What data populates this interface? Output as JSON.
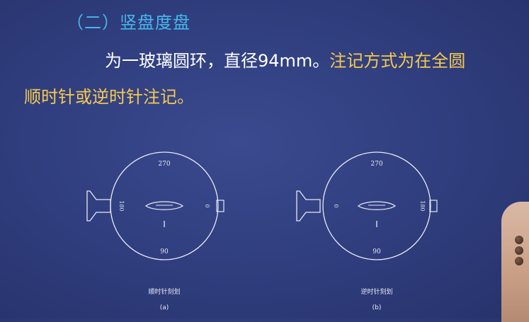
{
  "heading": "（二）竖盘度盘",
  "line1": {
    "white": "为一玻璃圆环，直径94mm。",
    "highlight": "注记方式为在全圆"
  },
  "line2": "顺时针或逆时针注记。",
  "figures": [
    {
      "label_top": "270",
      "label_bottom": "90",
      "label_left": "180",
      "label_right": "0",
      "caption": "顺时针刻划",
      "sub": "(a)"
    },
    {
      "label_top": "270",
      "label_bottom": "90",
      "label_left": "0",
      "label_right": "180",
      "caption": "逆时针刻划",
      "sub": "(b)"
    }
  ],
  "colors": {
    "heading": "#46b7ec",
    "highlight": "#f6c94d",
    "text": "#ffffff",
    "background": "#2f3d7d"
  }
}
